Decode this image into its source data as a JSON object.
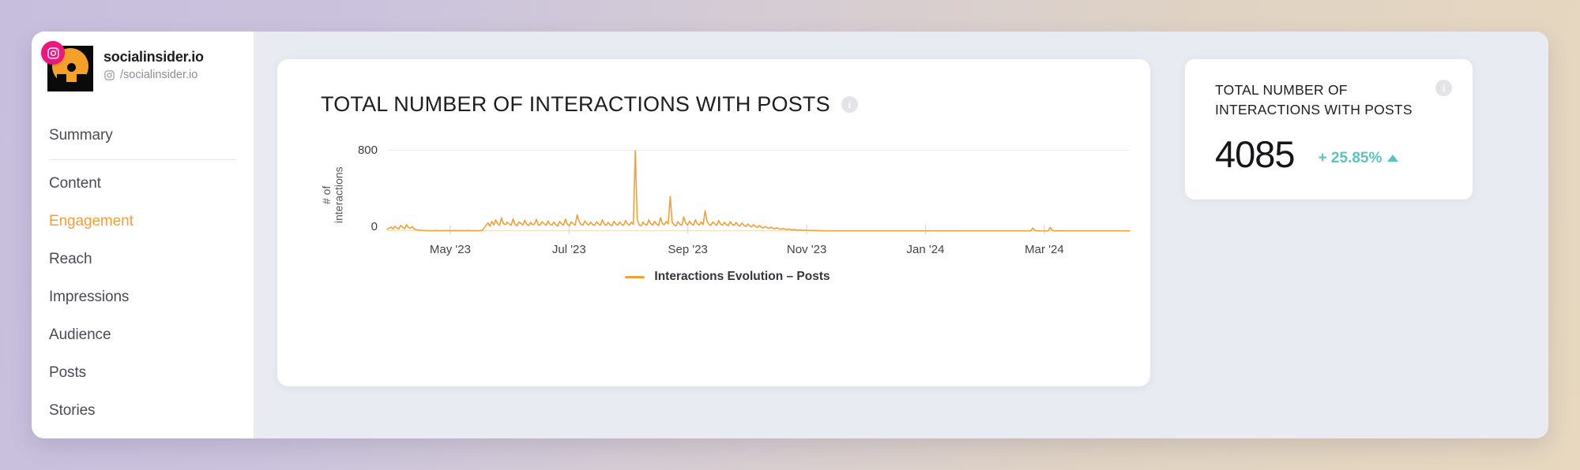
{
  "sidebar": {
    "profile": {
      "name": "socialinsider.io",
      "handle": "/socialinsider.io",
      "platform_icon": "instagram-icon"
    },
    "items": [
      {
        "label": "Summary",
        "active": false
      },
      {
        "label": "Content",
        "active": false
      },
      {
        "label": "Engagement",
        "active": true
      },
      {
        "label": "Reach",
        "active": false
      },
      {
        "label": "Impressions",
        "active": false
      },
      {
        "label": "Audience",
        "active": false
      },
      {
        "label": "Posts",
        "active": false
      },
      {
        "label": "Stories",
        "active": false
      }
    ]
  },
  "chart_card": {
    "title": "TOTAL NUMBER OF INTERACTIONS WITH POSTS",
    "info_icon": "info-icon",
    "info_glyph": "i"
  },
  "kpi_card": {
    "title": "TOTAL NUMBER OF INTERACTIONS WITH POSTS",
    "value": "4085",
    "delta": "+ 25.85%",
    "delta_direction": "up",
    "delta_color": "#5cc3be",
    "info_icon": "info-icon",
    "info_glyph": "i"
  },
  "colors": {
    "accent_orange": "#f0a03b",
    "active_nav": "#f0a03b",
    "teal": "#5cc3be",
    "panel_bg": "#e8ebf1",
    "card_bg": "#ffffff"
  },
  "chart_data": {
    "type": "line",
    "title": "TOTAL NUMBER OF INTERACTIONS WITH POSTS",
    "xlabel": "",
    "ylabel": "# of interactions",
    "ylim": [
      0,
      800
    ],
    "yticks": [
      0,
      800
    ],
    "ytick_labels": [
      "0",
      "800"
    ],
    "xtick_labels": [
      "May '23",
      "Jul '23",
      "Sep '23",
      "Nov '23",
      "Jan '24",
      "Mar '24"
    ],
    "xtick_positions": [
      0.085,
      0.245,
      0.405,
      0.565,
      0.725,
      0.885
    ],
    "grid": "y-only",
    "legend_position": "bottom-center",
    "series": [
      {
        "name": "Interactions Evolution – Posts",
        "color": "#f0a03b",
        "values": [
          18,
          26,
          40,
          22,
          48,
          30,
          20,
          55,
          38,
          24,
          62,
          35,
          28,
          45,
          20,
          14,
          10,
          8,
          6,
          5,
          4,
          4,
          3,
          3,
          4,
          5,
          4,
          3,
          3,
          4,
          4,
          5,
          4,
          3,
          4,
          5,
          4,
          3,
          4,
          4,
          3,
          4,
          5,
          4,
          3,
          4,
          4,
          3,
          4,
          6,
          30,
          55,
          80,
          48,
          95,
          60,
          110,
          72,
          58,
          130,
          75,
          62,
          88,
          70,
          58,
          120,
          66,
          52,
          90,
          74,
          60,
          105,
          68,
          55,
          85,
          62,
          70,
          115,
          58,
          64,
          92,
          70,
          56,
          100,
          66,
          58,
          88,
          62,
          50,
          95,
          70,
          58,
          118,
          66,
          54,
          90,
          72,
          58,
          160,
          95,
          66,
          58,
          100,
          72,
          60,
          88,
          64,
          56,
          92,
          70,
          58,
          112,
          68,
          56,
          86,
          62,
          54,
          96,
          70,
          58,
          90,
          64,
          56,
          104,
          72,
          58,
          88,
          66,
          790,
          120,
          60,
          52,
          88,
          66,
          58,
          110,
          72,
          60,
          95,
          68,
          56,
          130,
          74,
          62,
          96,
          70,
          340,
          88,
          60,
          52,
          92,
          66,
          58,
          140,
          78,
          60,
          96,
          70,
          58,
          110,
          72,
          58,
          88,
          64,
          200,
          96,
          66,
          58,
          90,
          70,
          56,
          105,
          68,
          58,
          86,
          62,
          54,
          92,
          66,
          56,
          84,
          60,
          50,
          78,
          58,
          46,
          70,
          52,
          40,
          62,
          46,
          36,
          54,
          40,
          30,
          46,
          34,
          26,
          38,
          28,
          22,
          32,
          24,
          18,
          26,
          20,
          14,
          20,
          14,
          10,
          16,
          10,
          8,
          12,
          8,
          6,
          9,
          6,
          5,
          7,
          5,
          4,
          5,
          4,
          3,
          3,
          2,
          2,
          2,
          2,
          2,
          2,
          2,
          2,
          2,
          2,
          2,
          2,
          2,
          2,
          2,
          2,
          2,
          2,
          2,
          2,
          2,
          2,
          2,
          2,
          2,
          2,
          2,
          2,
          2,
          2,
          2,
          2,
          2,
          2,
          2,
          2,
          2,
          2,
          2,
          2,
          2,
          2,
          2,
          2,
          2,
          2,
          2,
          2,
          2,
          2,
          2,
          2,
          2,
          2,
          2,
          2,
          2,
          2,
          2,
          2,
          2,
          2,
          2,
          2,
          2,
          2,
          2,
          2,
          2,
          2,
          2,
          2,
          2,
          2,
          2,
          2,
          2,
          2,
          2,
          2,
          2,
          2,
          2,
          2,
          2,
          2,
          2,
          2,
          2,
          2,
          2,
          2,
          2,
          2,
          2,
          2,
          2,
          2,
          2,
          2,
          2,
          2,
          2,
          2,
          2,
          2,
          2,
          30,
          8,
          2,
          2,
          2,
          2,
          2,
          2,
          2,
          36,
          10,
          2,
          2,
          2,
          2,
          2,
          2,
          2,
          2,
          2,
          2,
          2,
          2,
          2,
          2,
          2,
          2,
          2,
          2,
          2,
          2,
          2,
          2,
          2,
          2,
          2,
          2,
          2,
          2,
          2,
          2,
          2,
          2,
          2,
          2,
          2,
          2,
          2,
          2,
          2,
          2
        ]
      }
    ]
  }
}
